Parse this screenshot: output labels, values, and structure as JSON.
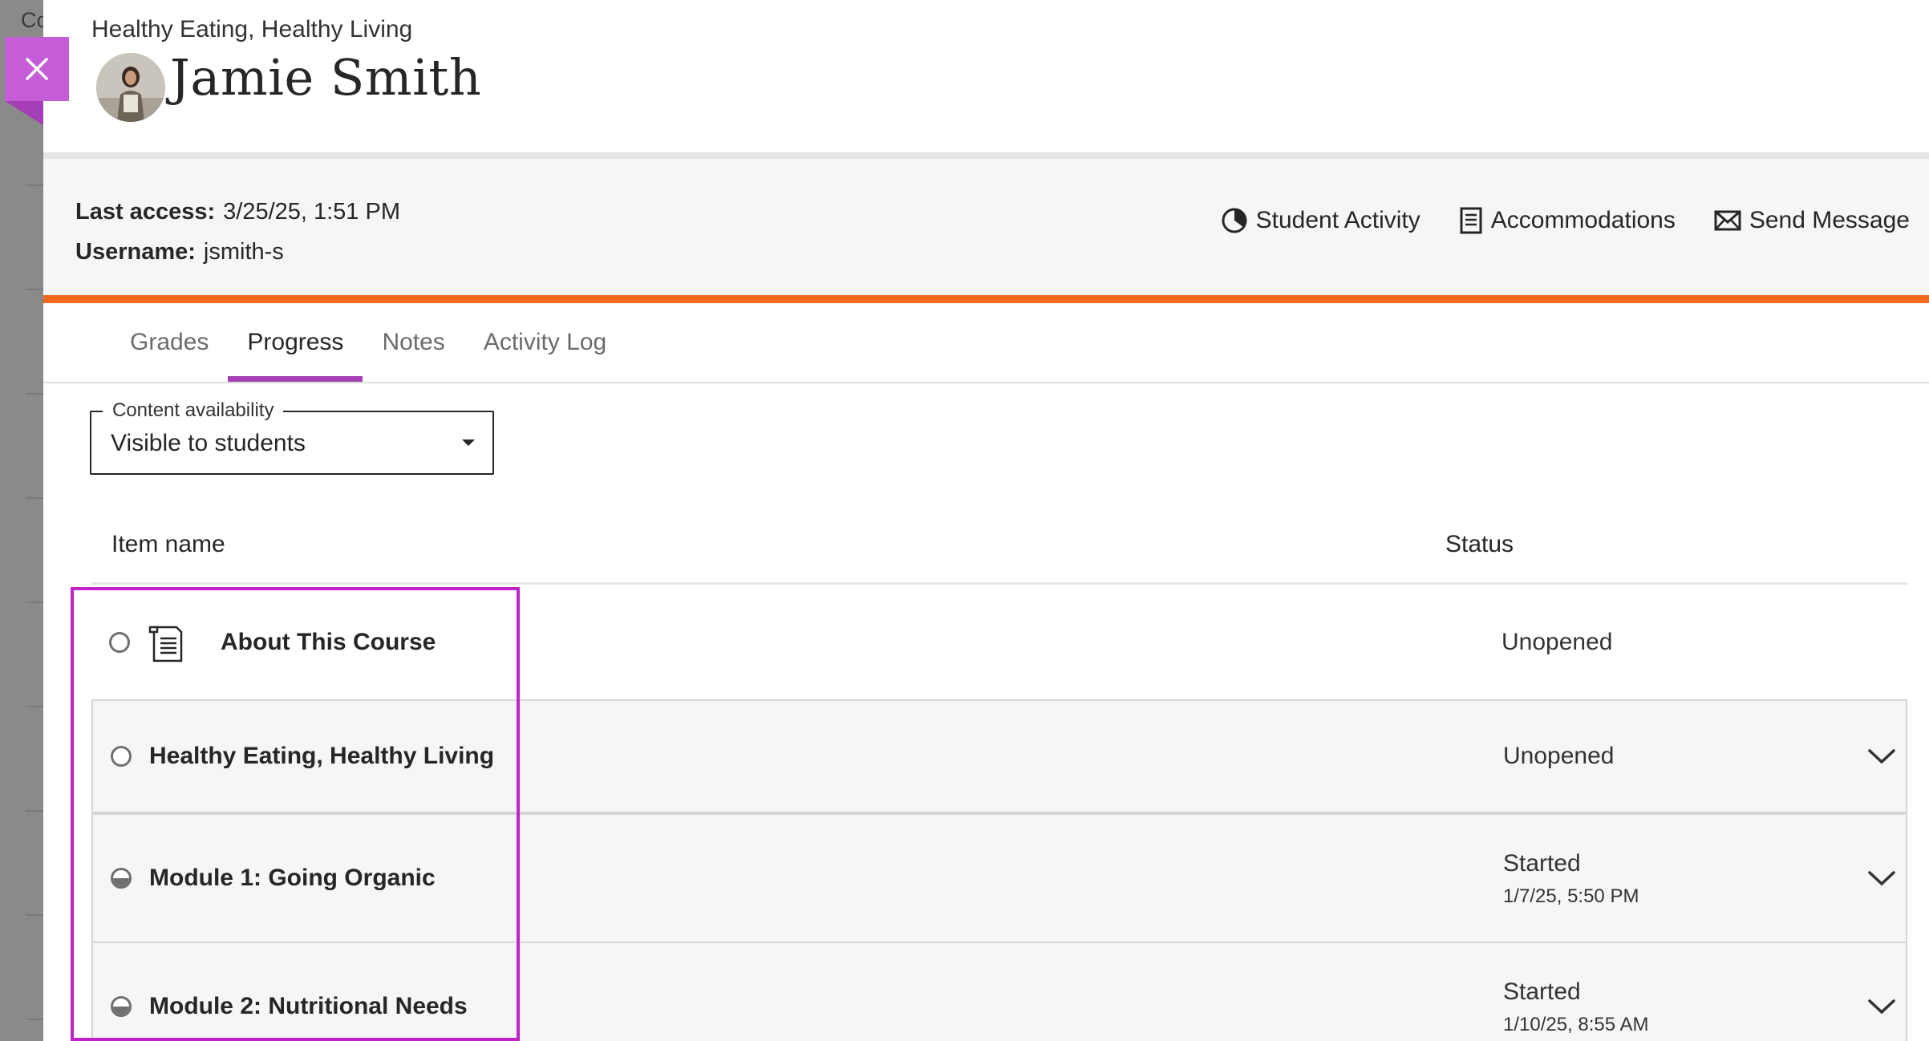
{
  "backdrop": {
    "peek_text": "Co"
  },
  "panel": {
    "course_title": "Healthy Eating, Healthy Living",
    "student_name": "Jamie Smith",
    "last_access_label": "Last access:",
    "last_access_value": "3/25/25, 1:51 PM",
    "username_label": "Username:",
    "username_value": "jsmith-s",
    "actions": [
      {
        "label": "Student Activity",
        "icon": "activity-clock-icon"
      },
      {
        "label": "Accommodations",
        "icon": "document-list-icon"
      },
      {
        "label": "Send Message",
        "icon": "envelope-icon"
      }
    ],
    "accent_color": "#f26a1b",
    "tab_accent_color": "#a53fb6"
  },
  "tabs": [
    {
      "label": "Grades",
      "active": false
    },
    {
      "label": "Progress",
      "active": true
    },
    {
      "label": "Notes",
      "active": false
    },
    {
      "label": "Activity Log",
      "active": false
    }
  ],
  "filter": {
    "legend": "Content availability",
    "value": "Visible to students"
  },
  "table": {
    "headers": {
      "item_name": "Item name",
      "status": "Status"
    },
    "rows": [
      {
        "name": "About This Course",
        "status": "Unopened",
        "date": "",
        "icon": "document-icon",
        "progress": "unopened",
        "expandable": false
      },
      {
        "name": "Healthy Eating, Healthy Living",
        "status": "Unopened",
        "date": "",
        "icon": "",
        "progress": "unopened",
        "expandable": true
      },
      {
        "name": "Module 1: Going Organic",
        "status": "Started",
        "date": "1/7/25, 5:50 PM",
        "icon": "",
        "progress": "started",
        "expandable": true
      },
      {
        "name": "Module 2: Nutritional Needs",
        "status": "Started",
        "date": "1/10/25, 8:55 AM",
        "icon": "",
        "progress": "started",
        "expandable": true
      }
    ]
  }
}
